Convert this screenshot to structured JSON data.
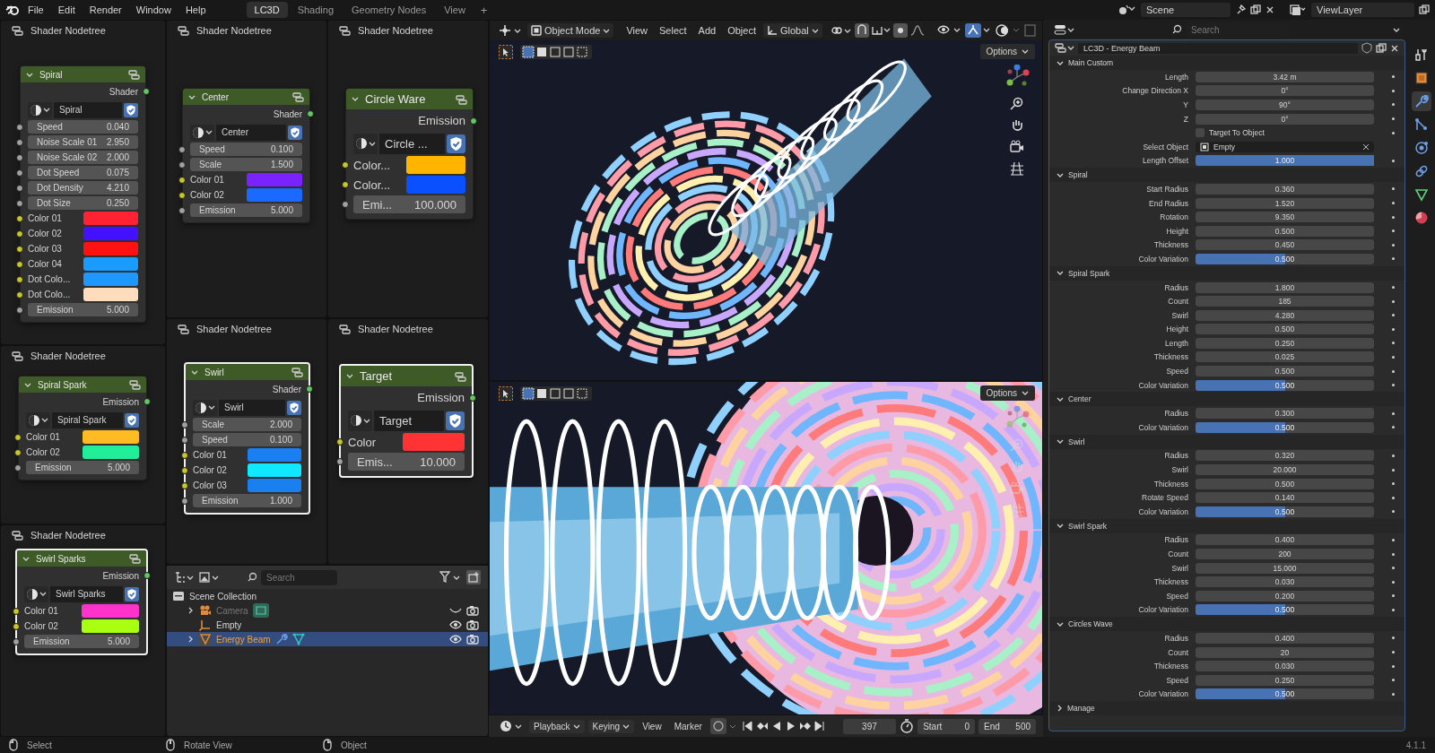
{
  "top_bar": {
    "menus": [
      "File",
      "Edit",
      "Render",
      "Window",
      "Help"
    ],
    "workspaces": [
      {
        "label": "LC3D",
        "selected": true
      },
      {
        "label": "Shading",
        "selected": false
      },
      {
        "label": "Geometry Nodes",
        "selected": false
      },
      {
        "label": "View",
        "selected": false
      }
    ],
    "add_tab": "+",
    "scene": "Scene",
    "view_layer": "ViewLayer"
  },
  "node_editors": [
    {
      "title": "Shader Nodetree",
      "node": {
        "title": "Spiral",
        "selected": false,
        "output": "Shader",
        "group": "Spiral",
        "fields": [
          {
            "kind": "value",
            "label": "Speed",
            "value": "0.040"
          },
          {
            "kind": "value",
            "label": "Noise Scale 01",
            "value": "2.950"
          },
          {
            "kind": "value",
            "label": "Noise Scale 02",
            "value": "2.000"
          },
          {
            "kind": "value",
            "label": "Dot Speed",
            "value": "0.075"
          },
          {
            "kind": "value",
            "label": "Dot Density",
            "value": "4.210"
          },
          {
            "kind": "value",
            "label": "Dot Size",
            "value": "0.250"
          },
          {
            "kind": "color",
            "label": "Color 01",
            "color": "#ff2233"
          },
          {
            "kind": "color",
            "label": "Color 02",
            "color": "#4411ff"
          },
          {
            "kind": "color",
            "label": "Color 03",
            "color": "#ff1111"
          },
          {
            "kind": "color",
            "label": "Color 04",
            "color": "#1a9cff"
          },
          {
            "kind": "color",
            "label": "Dot Colo...",
            "color": "#1e98ff"
          },
          {
            "kind": "color",
            "label": "Dot Colo...",
            "color": "#ffdcbc"
          },
          {
            "kind": "value",
            "label": "Emission",
            "value": "5.000"
          }
        ]
      }
    },
    {
      "title": "Shader Nodetree",
      "node": {
        "title": "Center",
        "selected": false,
        "output": "Shader",
        "group": "Center",
        "fields": [
          {
            "kind": "value",
            "label": "Speed",
            "value": "0.100"
          },
          {
            "kind": "value",
            "label": "Scale",
            "value": "1.500"
          },
          {
            "kind": "color",
            "label": "Color 01",
            "color": "#7a22ff"
          },
          {
            "kind": "color",
            "label": "Color 02",
            "color": "#1a6aff"
          },
          {
            "kind": "value",
            "label": "Emission",
            "value": "5.000"
          }
        ]
      }
    },
    {
      "title": "Shader Nodetree",
      "node": {
        "title": "Circle Ware",
        "selected": false,
        "output": "Emission",
        "group": "Circle ...",
        "fields": [
          {
            "kind": "color",
            "label": "Color...",
            "color": "#ffb500"
          },
          {
            "kind": "color",
            "label": "Color...",
            "color": "#0a50ff"
          },
          {
            "kind": "value",
            "label": "Emi...",
            "value": "100.000"
          }
        ]
      }
    },
    {
      "title": "Shader Nodetree",
      "node": {
        "title": "Spiral Spark",
        "selected": false,
        "output": "Emission",
        "group": "Spiral Spark",
        "fields": [
          {
            "kind": "color",
            "label": "Color 01",
            "color": "#ffbb22"
          },
          {
            "kind": "color",
            "label": "Color 02",
            "color": "#22ee99"
          },
          {
            "kind": "value",
            "label": "Emission",
            "value": "5.000"
          }
        ]
      }
    },
    {
      "title": "Shader Nodetree",
      "node": {
        "title": "Swirl",
        "selected": true,
        "output": "Shader",
        "group": "Swirl",
        "fields": [
          {
            "kind": "value",
            "label": "Scale",
            "value": "2.000"
          },
          {
            "kind": "value",
            "label": "Speed",
            "value": "0.100"
          },
          {
            "kind": "color",
            "label": "Color 01",
            "color": "#1a7ff0"
          },
          {
            "kind": "color",
            "label": "Color 02",
            "color": "#10e8ff"
          },
          {
            "kind": "color",
            "label": "Color 03",
            "color": "#1a80f0"
          },
          {
            "kind": "value",
            "label": "Emission",
            "value": "1.000"
          }
        ]
      }
    },
    {
      "title": "Shader Nodetree",
      "node": {
        "title": "Target",
        "selected": true,
        "output": "Emission",
        "group": "Target",
        "fields": [
          {
            "kind": "color",
            "label": "Color",
            "color": "#ff3333"
          },
          {
            "kind": "value",
            "label": "Emis...",
            "value": "10.000"
          }
        ]
      }
    },
    {
      "title": "Shader Nodetree",
      "node": {
        "title": "Swirl Sparks",
        "selected": true,
        "output": "Emission",
        "group": "Swirl Sparks",
        "fields": [
          {
            "kind": "color",
            "label": "Color 01",
            "color": "#ff33cc"
          },
          {
            "kind": "color",
            "label": "Color 02",
            "color": "#aaff11"
          },
          {
            "kind": "value",
            "label": "Emission",
            "value": "5.000"
          }
        ]
      }
    }
  ],
  "outliner": {
    "search_placeholder": "Search",
    "tree": [
      {
        "name": "Scene Collection",
        "kind": "collection",
        "selected": false,
        "children": [
          {
            "name": "Camera",
            "kind": "camera",
            "selected": false,
            "visible": false,
            "expandable": true,
            "extras": [
              {
                "kind": "camera_data"
              }
            ]
          },
          {
            "name": "Empty",
            "kind": "empty",
            "selected": false,
            "visible": true,
            "expandable": false
          },
          {
            "name": "Energy Beam",
            "kind": "mesh",
            "selected": true,
            "visible": true,
            "expandable": true,
            "extras": [
              {
                "kind": "modifier"
              },
              {
                "kind": "mesh_data"
              }
            ]
          }
        ]
      }
    ]
  },
  "viewport": {
    "mode": "Object Mode",
    "menus": [
      "View",
      "Select",
      "Add",
      "Object"
    ],
    "orientation": "Global",
    "options": "Options"
  },
  "viewport_2": {
    "options": "Options"
  },
  "timeline": {
    "menus": [
      {
        "label": "Playback",
        "dropdown": true
      },
      {
        "label": "Keying",
        "dropdown": true
      },
      {
        "label": "View",
        "dropdown": false
      },
      {
        "label": "Marker",
        "dropdown": false
      }
    ],
    "frame": "397",
    "start_label": "Start",
    "start": "0",
    "end_label": "End",
    "end": "500"
  },
  "properties": {
    "search_placeholder": "Search",
    "object": "LC3D - Energy Beam",
    "sections": [
      {
        "title": "Main Custom",
        "expanded": true,
        "rows": [
          {
            "kind": "number",
            "label": "Length",
            "value": "3.42 m"
          },
          {
            "kind": "number",
            "label": "Change Direction X",
            "value": "0°"
          },
          {
            "kind": "number",
            "label": "Y",
            "value": "90°"
          },
          {
            "kind": "number",
            "label": "Z",
            "value": "0°"
          },
          {
            "kind": "checkbox",
            "label": "Target To Object",
            "checked": false
          },
          {
            "kind": "object",
            "label": "Select Object",
            "value": "Empty"
          },
          {
            "kind": "slider",
            "label": "Length Offset",
            "value": "1.000",
            "level": 1
          }
        ]
      },
      {
        "title": "Spiral",
        "expanded": true,
        "rows": [
          {
            "kind": "number",
            "label": "Start Radius",
            "value": "0.360"
          },
          {
            "kind": "number",
            "label": "End Radius",
            "value": "1.520"
          },
          {
            "kind": "number",
            "label": "Rotation",
            "value": "9.350"
          },
          {
            "kind": "number",
            "label": "Height",
            "value": "0.500"
          },
          {
            "kind": "number",
            "label": "Thickness",
            "value": "0.450"
          },
          {
            "kind": "slider",
            "label": "Color Variation",
            "value": "0.500",
            "level": 0.5
          }
        ]
      },
      {
        "title": "Spiral Spark",
        "expanded": true,
        "rows": [
          {
            "kind": "number",
            "label": "Radius",
            "value": "1.800"
          },
          {
            "kind": "number",
            "label": "Count",
            "value": "185"
          },
          {
            "kind": "number",
            "label": "Swirl",
            "value": "4.280"
          },
          {
            "kind": "number",
            "label": "Height",
            "value": "0.500"
          },
          {
            "kind": "number",
            "label": "Length",
            "value": "0.250"
          },
          {
            "kind": "number",
            "label": "Thickness",
            "value": "0.025"
          },
          {
            "kind": "number",
            "label": "Speed",
            "value": "0.500"
          },
          {
            "kind": "slider",
            "label": "Color Variation",
            "value": "0.500",
            "level": 0.5
          }
        ]
      },
      {
        "title": "Center",
        "expanded": true,
        "rows": [
          {
            "kind": "number",
            "label": "Radius",
            "value": "0.300"
          },
          {
            "kind": "slider",
            "label": "Color Variation",
            "value": "0.500",
            "level": 0.5
          }
        ]
      },
      {
        "title": "Swirl",
        "expanded": true,
        "rows": [
          {
            "kind": "number",
            "label": "Radius",
            "value": "0.320"
          },
          {
            "kind": "number",
            "label": "Swirl",
            "value": "20.000"
          },
          {
            "kind": "number",
            "label": "Thickness",
            "value": "0.500"
          },
          {
            "kind": "number",
            "label": "Rotate Speed",
            "value": "0.140"
          },
          {
            "kind": "slider",
            "label": "Color Variation",
            "value": "0.500",
            "level": 0.5
          }
        ]
      },
      {
        "title": "Swirl Spark",
        "expanded": true,
        "rows": [
          {
            "kind": "number",
            "label": "Radius",
            "value": "0.400"
          },
          {
            "kind": "number",
            "label": "Count",
            "value": "200"
          },
          {
            "kind": "number",
            "label": "Swirl",
            "value": "15.000"
          },
          {
            "kind": "number",
            "label": "Thickness",
            "value": "0.030"
          },
          {
            "kind": "number",
            "label": "Speed",
            "value": "0.200"
          },
          {
            "kind": "slider",
            "label": "Color Variation",
            "value": "0.500",
            "level": 0.5
          }
        ]
      },
      {
        "title": "Circles Wave",
        "expanded": true,
        "rows": [
          {
            "kind": "number",
            "label": "Radius",
            "value": "0.400"
          },
          {
            "kind": "number",
            "label": "Count",
            "value": "20"
          },
          {
            "kind": "number",
            "label": "Thickness",
            "value": "0.030"
          },
          {
            "kind": "number",
            "label": "Speed",
            "value": "0.250"
          },
          {
            "kind": "slider",
            "label": "Color Variation",
            "value": "0.500",
            "level": 0.5
          }
        ]
      },
      {
        "title": "Manage",
        "expanded": false
      }
    ]
  },
  "property_tabs": [
    {
      "kind": "tool",
      "selected": false
    },
    {
      "kind": "object",
      "selected": false
    },
    {
      "kind": "modifier",
      "selected": true
    },
    {
      "kind": "particles",
      "selected": false
    },
    {
      "kind": "physics",
      "selected": false
    },
    {
      "kind": "constraints",
      "selected": false
    },
    {
      "kind": "data",
      "selected": false
    },
    {
      "kind": "material",
      "selected": false
    }
  ],
  "status_bar": {
    "items": [
      {
        "kind": "left_click",
        "label": "Select"
      },
      {
        "kind": "middle_click",
        "label": "Rotate View"
      },
      {
        "kind": "right_click",
        "label": "Object"
      }
    ],
    "version": "4.1.1"
  }
}
